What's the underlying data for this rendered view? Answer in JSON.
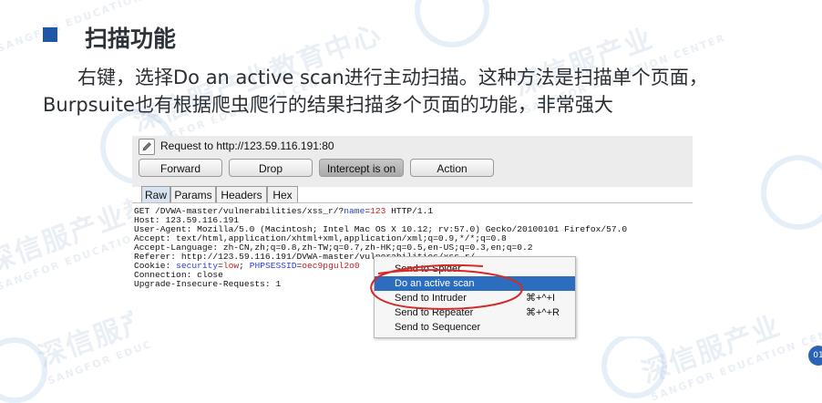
{
  "slide": {
    "title": "扫描功能",
    "paragraph_line1": "右键，选择Do an active scan进行主动扫描。这种方法是扫描单个页面，",
    "paragraph_line2": "Burpsuite也有根据爬虫爬行的结果扫描多个页面的功能，非常强大",
    "page_number": "01"
  },
  "watermark": {
    "zh_a": "深信服产业教育中心",
    "zh_b": "深信服产业",
    "en_a": "SANGFOR EDUCATION CENTER",
    "en_b": "SANGFOR EDUC"
  },
  "burp": {
    "request_label": "Request to http://123.59.116.191:80",
    "buttons": {
      "forward": "Forward",
      "drop": "Drop",
      "intercept": "Intercept is on",
      "action": "Action"
    },
    "tabs": [
      "Raw",
      "Params",
      "Headers",
      "Hex"
    ],
    "request": {
      "line1_prefix": "GET /DVWA-master/vulnerabilities/xss_r/?",
      "line1_param": "name",
      "line1_eq": "=",
      "line1_value": "123",
      "line1_suffix": " HTTP/1.1",
      "host": "Host: 123.59.116.191",
      "user_agent": "User-Agent: Mozilla/5.0 (Macintosh; Intel Mac OS X 10.12; rv:57.0) Gecko/20100101 Firefox/57.0",
      "accept": "Accept: text/html,application/xhtml+xml,application/xml;q=0.9,*/*;q=0.8",
      "accept_language": "Accept-Language: zh-CN,zh;q=0.8,zh-TW;q=0.7,zh-HK;q=0.5,en-US;q=0.3,en;q=0.2",
      "referer": "Referer: http://123.59.116.191/DVWA-master/vulnerabilities/xss_r/",
      "cookie_prefix": "Cookie: ",
      "cookie_name1": "security",
      "cookie_val1": "low",
      "cookie_sep": "; ",
      "cookie_name2": "PHPSESSID",
      "cookie_val2": "oec9pgul2o0",
      "connection": "Connection: close",
      "upgrade": "Upgrade-Insecure-Requests: 1"
    }
  },
  "context_menu": {
    "items": [
      {
        "label": "Send to Spider",
        "shortcut": ""
      },
      {
        "label": "Do an active scan",
        "shortcut": ""
      },
      {
        "label": "Send to Intruder",
        "shortcut": "⌘+^+I"
      },
      {
        "label": "Send to Repeater",
        "shortcut": "⌘+^+R"
      },
      {
        "label": "Send to Sequencer",
        "shortcut": ""
      }
    ]
  },
  "colors": {
    "accent": "#1e57a7",
    "menu_highlight": "#2c6dbf",
    "annotation": "#d42a2a",
    "param_value": "#c21f1f",
    "param_name": "#2a3fd6"
  }
}
